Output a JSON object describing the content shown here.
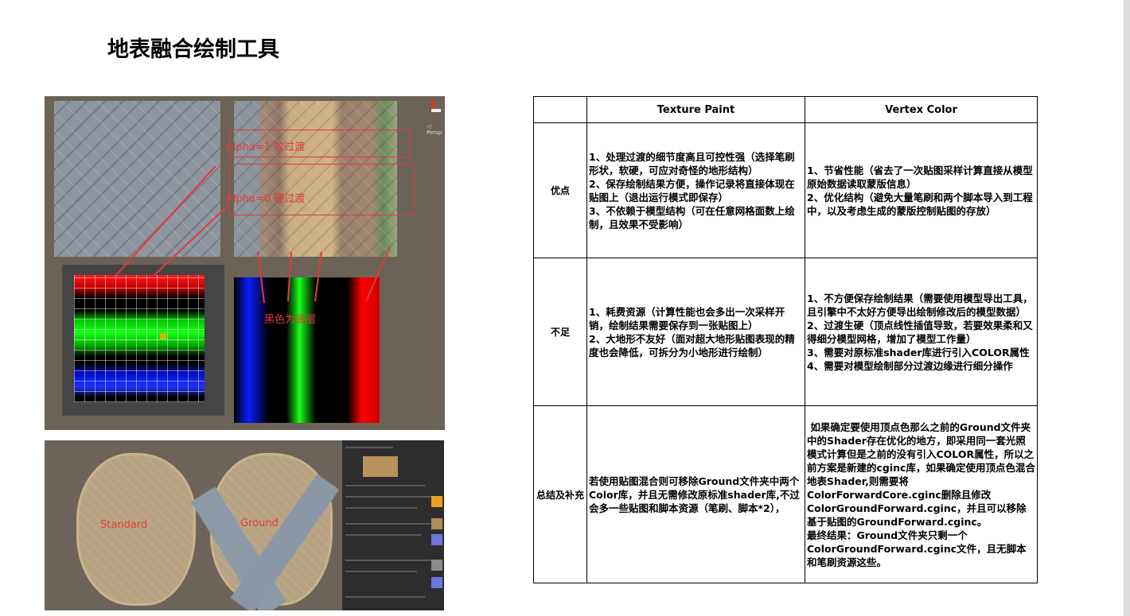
{
  "title": "地表融合绘制工具",
  "figure_top": {
    "annotation_1": "Alpha=1 软过渡",
    "annotation_2": "Alpha=0 硬过渡",
    "annotation_3": "黑色为底层",
    "gizmo_label": "◁ Persp"
  },
  "figure_bottom": {
    "label_left": "Standard",
    "label_right": "Ground"
  },
  "table": {
    "headers": [
      "",
      "Texture Paint",
      "Vertex Color"
    ],
    "rows": [
      {
        "label": "优点",
        "texture_paint": "1、处理过渡的细节度高且可控性强（选择笔刷形状，软硬，可应对奇怪的地形结构）\n2、保存绘制结果方便，操作记录将直接体现在贴图上（退出运行模式即保存）\n3、不依赖于模型结构（可在任意网格面数上绘制，且效果不受影响）",
        "vertex_color": "1、节省性能（省去了一次贴图采样计算直接从模型原始数据读取蒙版信息）\n2、优化结构（避免大量笔刷和两个脚本导入到工程中，以及考虑生成的蒙版控制贴图的存放）"
      },
      {
        "label": "不足",
        "texture_paint": "1、耗费资源（计算性能也会多出一次采样开销，绘制结果需要保存到一张贴图上）\n2、大地形不友好（面对超大地形贴图表现的精度也会降低，可拆分为小地形进行绘制）",
        "vertex_color": "1、不方便保存绘制结果（需要使用模型导出工具，且引擎中不太好方便导出绘制修改后的模型数据）\n2、过渡生硬（顶点线性插值导致，若要效果柔和又得细分模型网格，增加了模型工作量）\n3、需要对原标准shader库进行引入COLOR属性\n4、需要对模型绘制部分过渡边缘进行细分操作"
      },
      {
        "label": "总结及补充",
        "texture_paint": "若使用贴图混合则可移除Ground文件夹中两个Color库，并且无需修改原标准shader库,不过会多一些贴图和脚本资源（笔刷、脚本*2），",
        "vertex_color": " 如果确定要使用顶点色那么之前的Ground文件夹中的Shader存在优化的地方，即采用同一套光照模式计算但是之前的没有引入COLOR属性，所以之前方案是新建的cginc库，如果确定使用顶点色混合地表Shader,则需要将ColorForwardCore.cginc删除且修改ColorGroundForward.cginc，并且可以移除基于贴图的GroundForward.cginc。\n最终结果：Ground文件夹只剩一个ColorGroundForward.cginc文件，且无脚本和笔刷资源这些。"
      }
    ]
  }
}
